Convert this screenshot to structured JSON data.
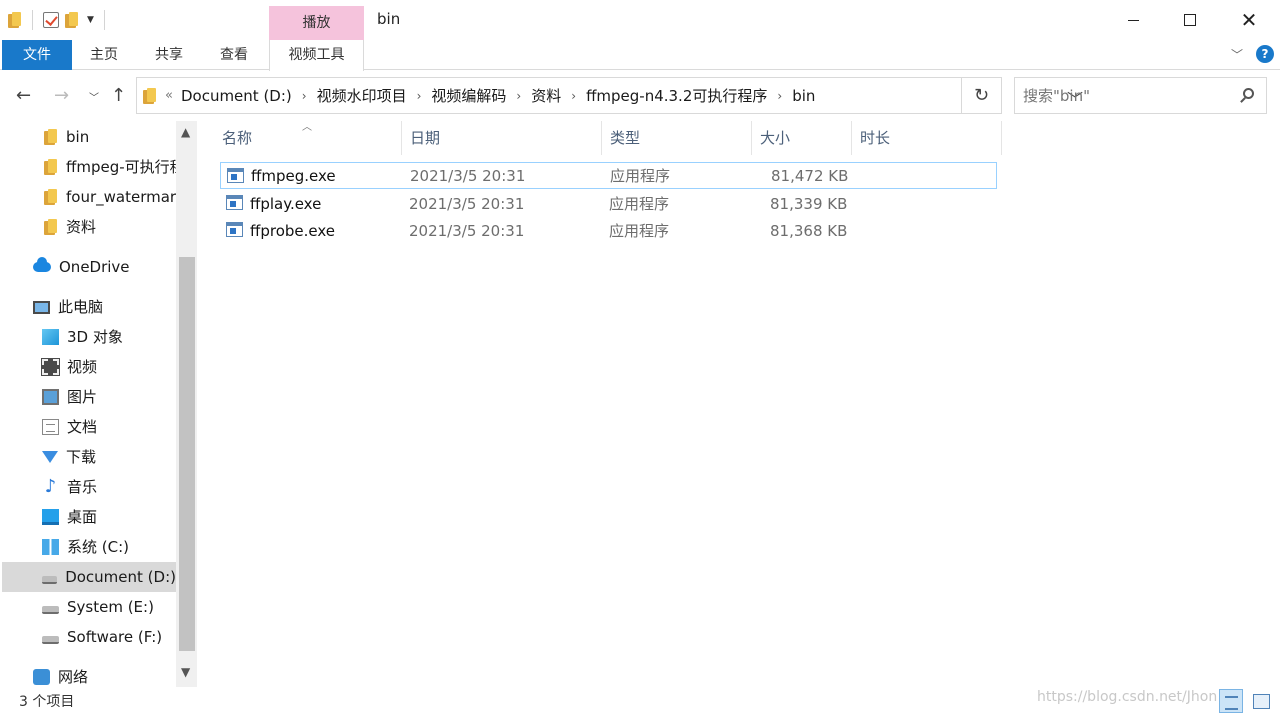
{
  "window": {
    "title": "bin",
    "context_tab_top": "播放"
  },
  "ribbon": {
    "tabs": [
      "文件",
      "主页",
      "共享",
      "查看",
      "视频工具"
    ],
    "accent_color": "#1979ca",
    "context_color": "#f5c3dc"
  },
  "address": {
    "overflow": "«",
    "crumbs": [
      "Document (D:)",
      "视频水印项目",
      "视频编解码",
      "资料",
      "ffmpeg-n4.3.2可执行程序",
      "bin"
    ]
  },
  "search": {
    "placeholder": "搜索\"bin\""
  },
  "navpane": {
    "quick_access": [
      "bin",
      "ffmpeg-可执行程",
      "four_watermarl",
      "资料"
    ],
    "onedrive": "OneDrive",
    "this_pc": "此电脑",
    "pc_items": [
      {
        "label": "3D 对象",
        "icon": "3d-objects-icon"
      },
      {
        "label": "视频",
        "icon": "video-icon"
      },
      {
        "label": "图片",
        "icon": "pictures-icon"
      },
      {
        "label": "文档",
        "icon": "documents-icon"
      },
      {
        "label": "下载",
        "icon": "downloads-icon"
      },
      {
        "label": "音乐",
        "icon": "music-icon"
      },
      {
        "label": "桌面",
        "icon": "desktop-icon"
      },
      {
        "label": "系统 (C:)",
        "icon": "windows-drive-icon"
      },
      {
        "label": "Document (D:)",
        "icon": "drive-icon"
      },
      {
        "label": "System (E:)",
        "icon": "drive-icon"
      },
      {
        "label": "Software (F:)",
        "icon": "drive-icon"
      }
    ],
    "selected": "Document (D:)",
    "network": "网络"
  },
  "columns": [
    "名称",
    "日期",
    "类型",
    "大小",
    "时长"
  ],
  "files": [
    {
      "name": "ffmpeg.exe",
      "date": "2021/3/5 20:31",
      "type": "应用程序",
      "size": "81,472 KB"
    },
    {
      "name": "ffplay.exe",
      "date": "2021/3/5 20:31",
      "type": "应用程序",
      "size": "81,339 KB"
    },
    {
      "name": "ffprobe.exe",
      "date": "2021/3/5 20:31",
      "type": "应用程序",
      "size": "81,368 KB"
    }
  ],
  "status": {
    "item_count": "3 个项目",
    "watermark": "https://blog.csdn.net/Jhon"
  }
}
